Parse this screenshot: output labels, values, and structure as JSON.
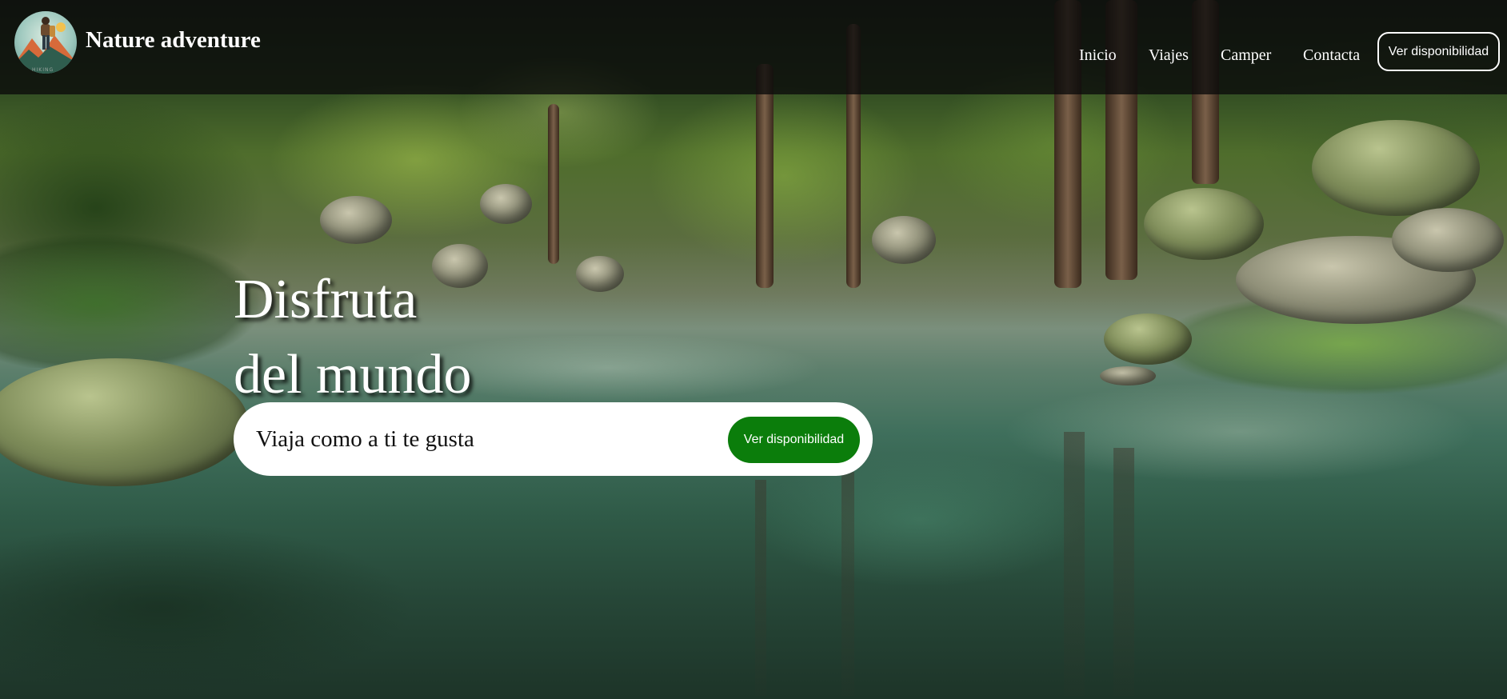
{
  "header": {
    "logo_icon": "hiker-mountain-logo-icon",
    "logo_caption": "HIKING",
    "brand": "Nature adventure",
    "nav": [
      {
        "label": "Inicio"
      },
      {
        "label": "Viajes"
      },
      {
        "label": "Camper"
      },
      {
        "label": "Contacta"
      }
    ],
    "cta_label": "Ver disponibilidad"
  },
  "hero": {
    "title_line1": "Disfruta",
    "title_line2": "del mundo",
    "search": {
      "placeholder": "Viaja como a ti te gusta",
      "button_label": "Ver disponibilidad"
    }
  },
  "colors": {
    "header_bg": "#0a0a0a",
    "accent_green": "#0b7d0b",
    "text_light": "#ffffff"
  }
}
